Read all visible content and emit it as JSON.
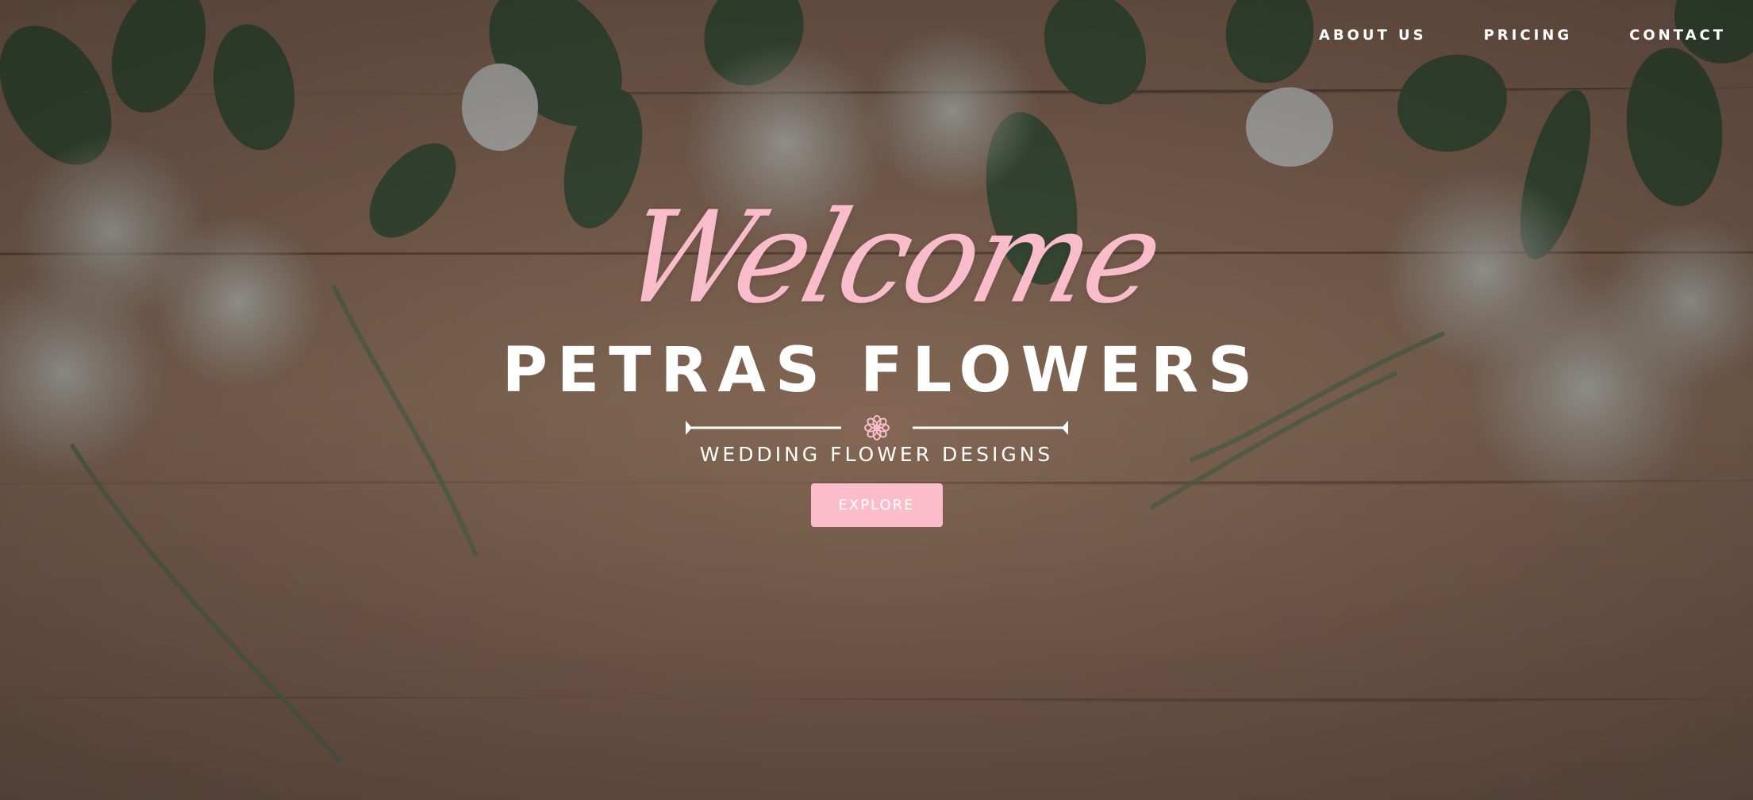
{
  "nav": {
    "items": [
      {
        "label": "ABOUT US"
      },
      {
        "label": "PRICING"
      },
      {
        "label": "CONTACT"
      }
    ]
  },
  "hero": {
    "script_title": "Welcome",
    "brand": "PETRAS FLOWERS",
    "tagline": "WEDDING FLOWER DESIGNS",
    "cta_label": "EXPLORE",
    "divider_icon": "flower-icon"
  },
  "colors": {
    "accent_pink": "#fcbdcb",
    "text_white": "#ffffff",
    "wood_brown": "#9a775e",
    "leaf_green": "#3f5a3b"
  }
}
